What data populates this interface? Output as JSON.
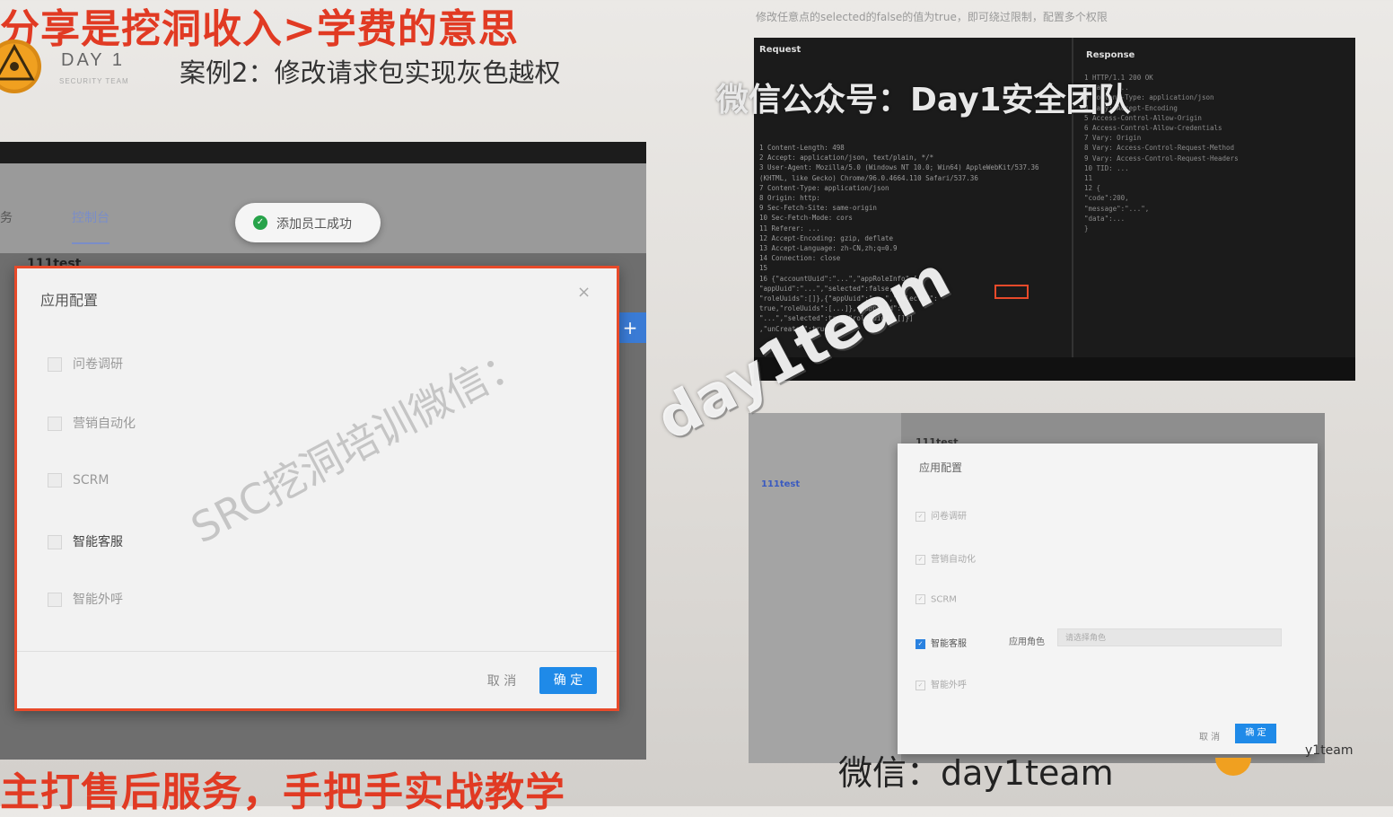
{
  "slide": {
    "top_title": "分享是挖洞收入>学费的意思",
    "bottom_title": "主打售后服务，手把手实战教学",
    "brand": "DAY 1",
    "brand_sub": "SECURITY TEAM",
    "case_title": "案例2：修改请求包实现灰色越权",
    "right_note": "修改任意点的selected的false的值为true，即可绕过限制，配置多个权限",
    "wx_overlay": "微信公众号：Day1安全团队",
    "wx_bottom": "微信：day1team",
    "day1team_small": "y1team"
  },
  "left_screenshot": {
    "nav_a": "务",
    "nav_b": "控制台",
    "toast_text": "添加员工成功",
    "bg_text": "111test",
    "add_button": "+",
    "dialog": {
      "title": "应用配置",
      "close": "×",
      "options": [
        "问卷调研",
        "营销自动化",
        "SCRM",
        "智能客服",
        "智能外呼"
      ],
      "cancel": "取 消",
      "ok": "确 定"
    }
  },
  "burp": {
    "request_label": "Request",
    "response_label": "Response",
    "request_lines": [
      "1 Content-Length: 498",
      "2 Accept: application/json, text/plain, */*",
      "3 User-Agent: Mozilla/5.0 (Windows NT 10.0; Win64) AppleWebKit/537.36",
      "   (KHTML, like Gecko) Chrome/96.0.4664.110 Safari/537.36",
      "7 Content-Type: application/json",
      "8 Origin: http:",
      "9 Sec-Fetch-Site: same-origin",
      "10 Sec-Fetch-Mode: cors",
      "11 Referer: ...",
      "12 Accept-Encoding: gzip, deflate",
      "13 Accept-Language: zh-CN,zh;q=0.9",
      "14 Connection: close",
      "15",
      "16 {\"accountUuid\":\"...\",\"appRoleInfo\":[{",
      "   \"appUuid\":\"...\",\"selected\":false,",
      "   \"roleUuids\":[]},{\"appUuid\":\"...\",\"selected\":",
      "   true,\"roleUuids\":[...]},{\"appUuid\":",
      "   \"...\",\"selected\":true,\"roleUuids\":[]}]",
      "   ,\"unCreated\":true}"
    ],
    "response_lines": [
      "1 HTTP/1.1 200 OK",
      "2 Date: ...",
      "3 Content-Type: application/json",
      "4 Vary: Accept-Encoding",
      "5 Access-Control-Allow-Origin",
      "6 Access-Control-Allow-Credentials",
      "7 Vary: Origin",
      "8 Vary: Access-Control-Request-Method",
      "9 Vary: Access-Control-Request-Headers",
      "10 TID: ...",
      "11",
      "12 {",
      "    \"code\":200,",
      "    \"message\":\"...\",",
      "    \"data\":...",
      "   }"
    ]
  },
  "right_screenshot": {
    "side_item": "111test",
    "bg_title": "111test",
    "dialog_title": "应用配置",
    "options": [
      "问卷调研",
      "营销自动化",
      "SCRM",
      "智能客服",
      "智能外呼"
    ],
    "role_label": "应用角色",
    "role_placeholder": "请选择角色",
    "cancel": "取 消",
    "ok": "确 定"
  },
  "watermarks": {
    "src": "SRC挖洞培训微信：",
    "team": "day1team"
  },
  "colors": {
    "accent_red": "#e13a23",
    "primary_blue": "#1f8ae8",
    "success_green": "#27a34a"
  }
}
